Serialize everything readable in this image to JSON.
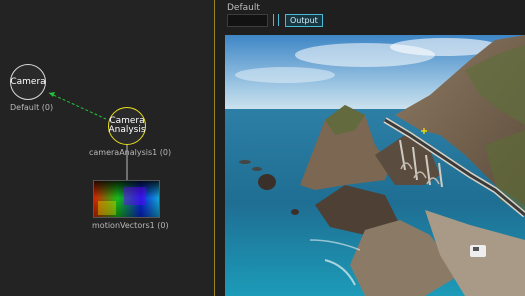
{
  "graph": {
    "nodes": {
      "camera": {
        "title": "Camera",
        "label": "Default (0)"
      },
      "analysis": {
        "title_line1": "Camera",
        "title_line2": "Analysis",
        "label": "cameraAnalysis1 (0)"
      },
      "motion_vectors": {
        "label": "motionVectors1 (0)"
      }
    },
    "edge_color": "#22c43a",
    "selected_color": "#e6e01e"
  },
  "viewer": {
    "title": "Default",
    "output_button": "Output",
    "accent_color": "#4bb8d6",
    "marker_color": "#ffe600"
  }
}
